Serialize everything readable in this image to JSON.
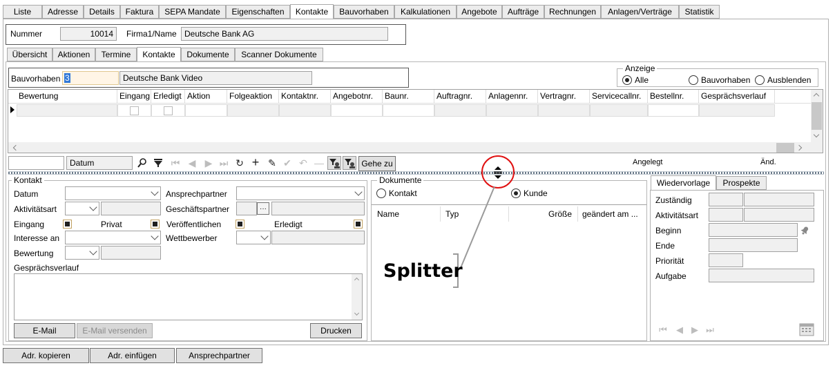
{
  "main_tabs": [
    "Liste",
    "Adresse",
    "Details",
    "Faktura",
    "SEPA Mandate",
    "Eigenschaften",
    "Kontakte",
    "Bauvorhaben",
    "Kalkulationen",
    "Angebote",
    "Aufträge",
    "Rechnungen",
    "Anlagen/Verträge",
    "Statistik"
  ],
  "header": {
    "nummer_label": "Nummer",
    "nummer_value": "10014",
    "firma_label": "Firma1/Name",
    "firma_value": "Deutsche Bank AG"
  },
  "sub_tabs": [
    "Übersicht",
    "Aktionen",
    "Termine",
    "Kontakte",
    "Dokumente",
    "Scanner Dokumente"
  ],
  "bauvorhaben": {
    "label": "Bauvorhaben",
    "id": "3",
    "name": "Deutsche Bank Video"
  },
  "anzeige": {
    "title": "Anzeige",
    "options": [
      "Alle",
      "Bauvorhaben",
      "Ausblenden"
    ],
    "selected": "Alle"
  },
  "grid": {
    "columns": [
      "Bewertung",
      "Eingang",
      "Erledigt",
      "Aktion",
      "Folgeaktion",
      "Kontaktnr.",
      "Angebotnr.",
      "Baunr.",
      "Auftragnr.",
      "Anlagennr.",
      "Vertragnr.",
      "Servicecallnr.",
      "Bestellnr.",
      "Gesprächsverlauf"
    ]
  },
  "toolbar": {
    "search_field": "Datum",
    "goto_label": "Gehe zu",
    "angelegt": "Angelegt",
    "aend": "Änd."
  },
  "kontakt": {
    "title": "Kontakt",
    "datum": "Datum",
    "aktivitaetsart": "Aktivitätsart",
    "eingang": "Eingang",
    "privat": "Privat",
    "interesse": "Interesse an",
    "bewertung": "Bewertung",
    "gespraech": "Gesprächsverlauf",
    "ansprechpartner": "Ansprechpartner",
    "geschaeftspartner": "Geschäftspartner",
    "veroeffentlichen": "Veröffentlichen",
    "erledigt": "Erledigt",
    "wettbewerber": "Wettbewerber",
    "email": "E-Mail",
    "email_send": "E-Mail versenden",
    "drucken": "Drucken"
  },
  "dokumente": {
    "title": "Dokumente",
    "options": [
      "Kontakt",
      "Kunde"
    ],
    "selected": "Kunde",
    "columns": [
      "Name",
      "Typ",
      "Größe",
      "geändert am ..."
    ]
  },
  "annotation": {
    "text": "Splitter"
  },
  "wiedervorlage": {
    "tabs": [
      "Wiedervorlage",
      "Prospekte"
    ],
    "fields": [
      "Zuständig",
      "Aktivitätsart",
      "Beginn",
      "Ende",
      "Priorität",
      "Aufgabe"
    ]
  },
  "bottom_buttons": [
    "Adr. kopieren",
    "Adr. einfügen",
    "Ansprechpartner"
  ],
  "colors": {
    "annotation_red": "#e01010",
    "annotation_line": "#9a9a9a"
  }
}
